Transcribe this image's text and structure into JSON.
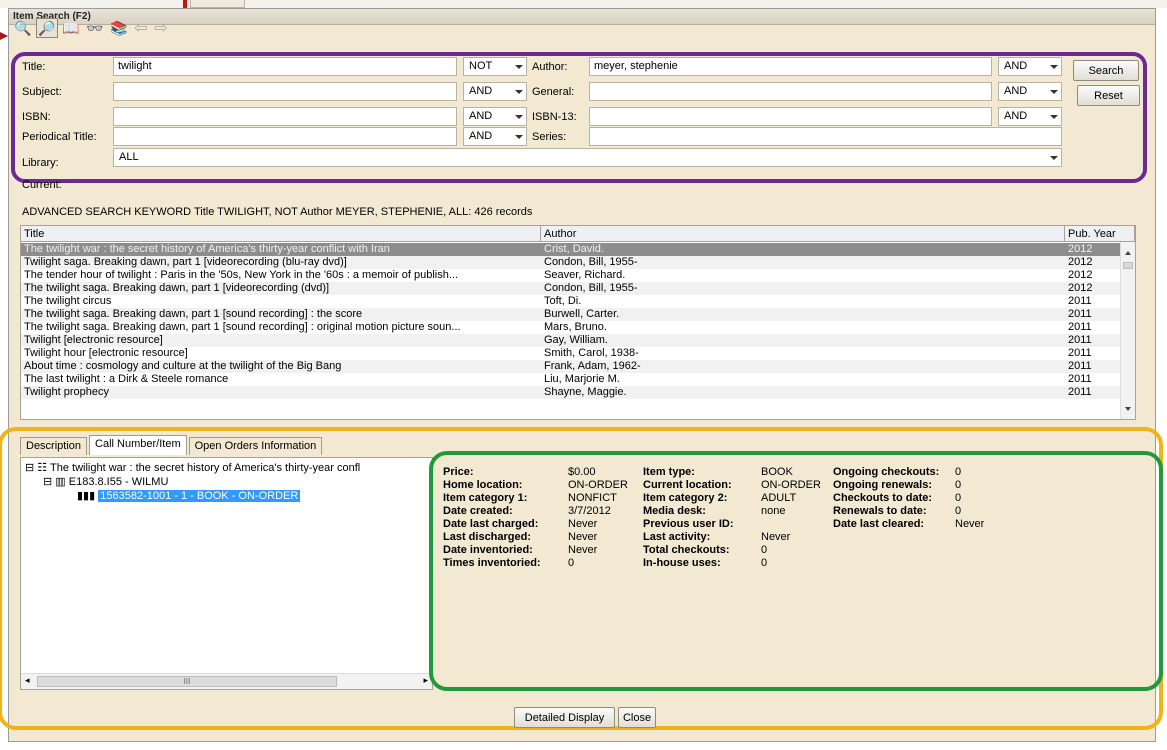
{
  "window": {
    "title": "Item Search (F2)"
  },
  "toolbar": {
    "buttons": [
      {
        "name": "advanced-search-tool-icon",
        "glyph": "🔍"
      },
      {
        "name": "binoculars-icon",
        "glyph": "🔎"
      },
      {
        "name": "item-search-icon",
        "glyph": "📖"
      },
      {
        "name": "glasses-icon",
        "glyph": "👓"
      },
      {
        "name": "browse-icon",
        "glyph": "📚"
      }
    ],
    "back_glyph": "⇦",
    "forward_glyph": "⇨"
  },
  "search": {
    "title_label": "Title:",
    "title_value": "twilight",
    "title_op": "NOT",
    "author_label": "Author:",
    "author_value": "meyer, stephenie",
    "author_op": "AND",
    "subject_label": "Subject:",
    "subject_value": "",
    "subject_op": "AND",
    "general_label": "General:",
    "general_value": "",
    "general_op": "AND",
    "isbn_label": "ISBN:",
    "isbn_value": "",
    "isbn_op": "AND",
    "isbn13_label": "ISBN-13:",
    "isbn13_value": "",
    "isbn13_op": "AND",
    "periodical_label": "Periodical Title:",
    "periodical_value": "",
    "periodical_op": "AND",
    "series_label": "Series:",
    "series_value": "",
    "library_label": "Library:",
    "library_value": "ALL",
    "search_button": "Search",
    "reset_button": "Reset"
  },
  "current_label": "Current:",
  "summary": "ADVANCED SEARCH KEYWORD Title TWILIGHT, NOT Author MEYER, STEPHENIE, ALL: 426 records",
  "results": {
    "columns": [
      "Title",
      "Author",
      "Pub. Year"
    ],
    "rows": [
      {
        "title": "The twilight war : the secret history of America's thirty-year conflict with Iran",
        "author": "Crist, David.",
        "year": "2012"
      },
      {
        "title": "Twilight saga. Breaking dawn, part 1 [videorecording (blu-ray dvd)]",
        "author": "Condon, Bill, 1955-",
        "year": "2012"
      },
      {
        "title": "The tender hour of twilight : Paris in the '50s, New York in the '60s : a memoir of publish...",
        "author": "Seaver, Richard.",
        "year": "2012"
      },
      {
        "title": "The twilight saga. Breaking dawn, part 1 [videorecording (dvd)]",
        "author": "Condon, Bill, 1955-",
        "year": "2012"
      },
      {
        "title": "The twilight circus",
        "author": "Toft, Di.",
        "year": "2011"
      },
      {
        "title": "The twilight saga. Breaking dawn, part 1 [sound recording] : the score",
        "author": "Burwell, Carter.",
        "year": "2011"
      },
      {
        "title": "The twilight saga. Breaking dawn, part 1 [sound recording] : original motion picture soun...",
        "author": "Mars, Bruno.",
        "year": "2011"
      },
      {
        "title": "Twilight [electronic resource]",
        "author": "Gay, William.",
        "year": "2011"
      },
      {
        "title": "Twilight hour [electronic resource]",
        "author": "Smith, Carol, 1938-",
        "year": "2011"
      },
      {
        "title": "About time : cosmology and culture at the twilight of the Big Bang",
        "author": "Frank, Adam, 1962-",
        "year": "2011"
      },
      {
        "title": "The last twilight : a Dirk & Steele romance",
        "author": "Liu, Marjorie M.",
        "year": "2011"
      },
      {
        "title": "Twilight prophecy",
        "author": "Shayne, Maggie.",
        "year": "2011"
      }
    ]
  },
  "tabs": [
    "Description",
    "Call Number/Item",
    "Open Orders Information"
  ],
  "tree": {
    "root": "The twilight war : the secret history of America's thirty-year confl",
    "call_number": "E183.8.I55 - WILMU",
    "item": "1563582-1001 - 1 - BOOK - ON-ORDER",
    "hscroll_grip": "III"
  },
  "details": {
    "col1": [
      {
        "k": "Price:",
        "v": "$0.00"
      },
      {
        "k": "Home location:",
        "v": "ON-ORDER"
      },
      {
        "k": "Item category 1:",
        "v": "NONFICT"
      },
      {
        "k": "Date created:",
        "v": "3/7/2012"
      },
      {
        "k": "Date last charged:",
        "v": "Never"
      },
      {
        "k": "Last discharged:",
        "v": "Never"
      },
      {
        "k": "Date inventoried:",
        "v": "Never"
      },
      {
        "k": "Times inventoried:",
        "v": "0"
      }
    ],
    "col2": [
      {
        "k": "Item type:",
        "v": "BOOK"
      },
      {
        "k": "Current location:",
        "v": "ON-ORDER"
      },
      {
        "k": "Item category 2:",
        "v": "ADULT"
      },
      {
        "k": "Media desk:",
        "v": "none"
      },
      {
        "k": "Previous user ID:",
        "v": ""
      },
      {
        "k": "Last activity:",
        "v": "Never"
      },
      {
        "k": "Total checkouts:",
        "v": "0"
      },
      {
        "k": "In-house uses:",
        "v": "0"
      }
    ],
    "col3": [
      {
        "k": "Ongoing checkouts:",
        "v": "0"
      },
      {
        "k": "Ongoing renewals:",
        "v": "0"
      },
      {
        "k": "Checkouts to date:",
        "v": "0"
      },
      {
        "k": "Renewals to date:",
        "v": "0"
      },
      {
        "k": "Date last cleared:",
        "v": "Never"
      }
    ]
  },
  "footer": {
    "detailed_display": "Detailed Display",
    "close": "Close"
  },
  "colors": {
    "form_border": "#6b2a93",
    "panel_border": "#f0b31a",
    "details_border": "#1f9a3a",
    "selection": "#3399ff"
  }
}
